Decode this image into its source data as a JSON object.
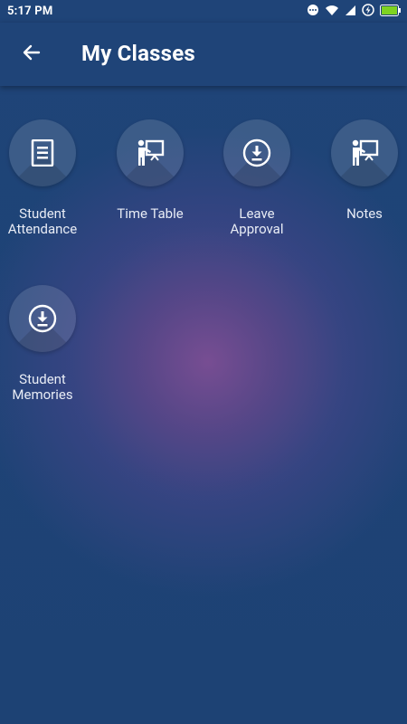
{
  "status_bar": {
    "time": "5:17 PM"
  },
  "app_bar": {
    "back_icon": "arrow-left-icon",
    "title": "My Classes"
  },
  "menu": {
    "items": [
      {
        "label": "Student\nAttendance",
        "icon": "document-icon"
      },
      {
        "label": "Time Table",
        "icon": "presentation-board-icon"
      },
      {
        "label": "Leave\nApproval",
        "icon": "download-circle-icon"
      },
      {
        "label": "Notes",
        "icon": "presentation-board-icon"
      },
      {
        "label": "Student\nMemories",
        "icon": "download-circle-icon"
      }
    ]
  },
  "colors": {
    "background": "#1f4478",
    "glow": "#7c4e94",
    "text": "#ffffff"
  }
}
